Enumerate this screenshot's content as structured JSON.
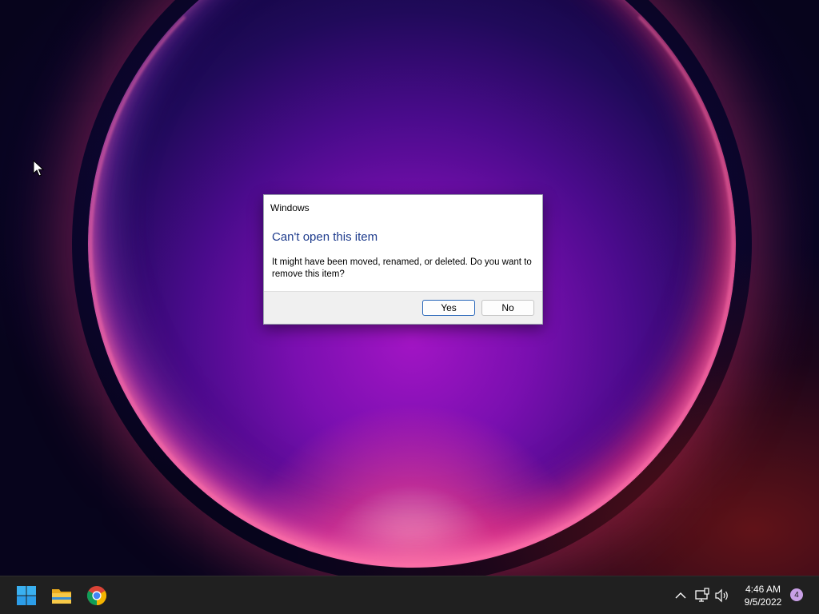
{
  "desktop": {
    "wallpaper": "windows-11-bloom-wallpaper"
  },
  "dialog": {
    "title": "Windows",
    "heading": "Can't open this item",
    "message": "It might have been moved, renamed, or deleted. Do you want to remove this item?",
    "buttons": {
      "yes": "Yes",
      "no": "No"
    },
    "heading_color": "#1c3a8c",
    "default_button_border": "#2463b8"
  },
  "taskbar": {
    "background": "#202020",
    "pinned": [
      {
        "name": "start",
        "icon": "windows-logo-icon"
      },
      {
        "name": "file-explorer",
        "icon": "folder-icon"
      },
      {
        "name": "chrome",
        "icon": "chrome-icon"
      }
    ],
    "tray": {
      "icons": [
        "chevron-up-icon",
        "network-icon",
        "volume-icon"
      ],
      "time": "4:46 AM",
      "date": "9/5/2022",
      "notification_count": "4"
    }
  }
}
